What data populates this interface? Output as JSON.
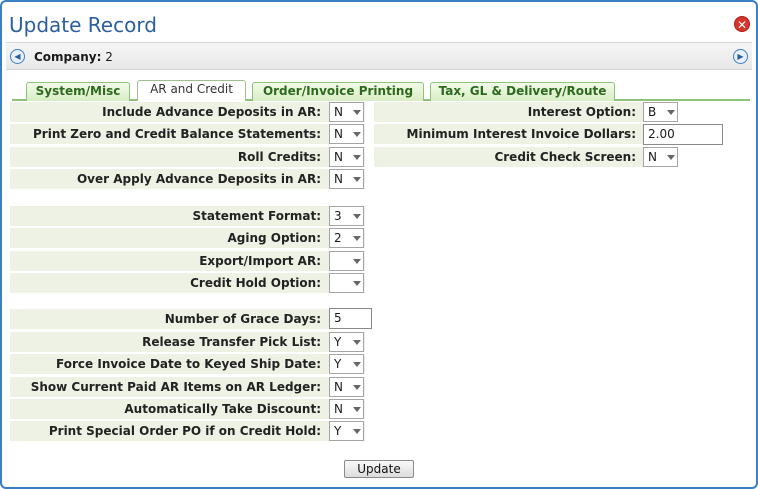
{
  "window": {
    "title": "Update Record"
  },
  "company": {
    "label": "Company:",
    "value": "2"
  },
  "tabs": [
    {
      "label": "System/Misc",
      "active": false
    },
    {
      "label": "AR and Credit",
      "active": true
    },
    {
      "label": "Order/Invoice Printing",
      "active": false
    },
    {
      "label": "Tax, GL & Delivery/Route",
      "active": false
    }
  ],
  "left_fields": [
    {
      "label": "Include Advance Deposits in AR:",
      "value": "N",
      "type": "select"
    },
    {
      "label": "Print Zero and Credit Balance Statements:",
      "value": "N",
      "type": "select"
    },
    {
      "label": "Roll Credits:",
      "value": "N",
      "type": "select"
    },
    {
      "label": "Over Apply Advance Deposits in AR:",
      "value": "N",
      "type": "select"
    },
    {
      "label": "Statement Format:",
      "value": "3",
      "type": "select"
    },
    {
      "label": "Aging Option:",
      "value": "2",
      "type": "select"
    },
    {
      "label": "Export/Import AR:",
      "value": "",
      "type": "select"
    },
    {
      "label": "Credit Hold Option:",
      "value": "",
      "type": "select"
    },
    {
      "label": "Number of Grace Days:",
      "value": "5",
      "type": "text"
    },
    {
      "label": "Release Transfer Pick List:",
      "value": "Y",
      "type": "select"
    },
    {
      "label": "Force Invoice Date to Keyed Ship Date:",
      "value": "Y",
      "type": "select"
    },
    {
      "label": "Show Current Paid AR Items on AR Ledger:",
      "value": "N",
      "type": "select"
    },
    {
      "label": "Automatically Take Discount:",
      "value": "N",
      "type": "select"
    },
    {
      "label": "Print Special Order PO if on Credit Hold:",
      "value": "Y",
      "type": "select"
    }
  ],
  "right_fields": [
    {
      "label": "Interest Option:",
      "value": "B",
      "type": "select"
    },
    {
      "label": "Minimum Interest Invoice Dollars:",
      "value": "2.00",
      "type": "text"
    },
    {
      "label": "Credit Check Screen:",
      "value": "N",
      "type": "select"
    }
  ],
  "actions": {
    "update_label": "Update"
  },
  "colors": {
    "accent": "#3a7fc4",
    "tab_green": "#8cc27a",
    "row_bg": "#eef2e4",
    "close_red": "#d9342b"
  },
  "icons": {
    "close": "close-icon",
    "prev": "arrow-left-icon",
    "next": "arrow-right-icon",
    "dropdown": "chevron-down-icon"
  }
}
